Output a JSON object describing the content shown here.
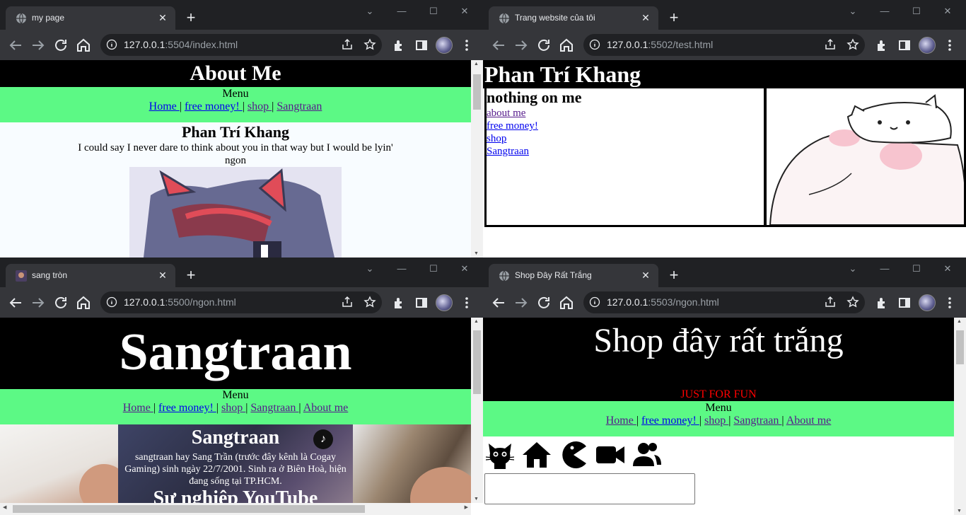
{
  "windows": [
    {
      "tab_title": "my page",
      "url_host": "127.0.0.1",
      "url_rest": ":5504/index.html",
      "page": {
        "header": "About Me",
        "menu_label": "Menu",
        "links": [
          "Home ",
          "free money! ",
          "shop ",
          "Sangtraan"
        ],
        "name": "Phan Trí Khang",
        "quote": "I could say I never dare to think about you in that way but I would be lyin'",
        "caption": "ngon"
      }
    },
    {
      "tab_title": "Trang website của tôi",
      "url_host": "127.0.0.1",
      "url_rest": ":5502/test.html",
      "page": {
        "header": "Phan Trí Khang",
        "box_title": "nothing on me",
        "links": [
          "about me",
          "free money!",
          "shop",
          "Sangtraan"
        ]
      }
    },
    {
      "tab_title": "sang tròn",
      "url_host": "127.0.0.1",
      "url_rest": ":5500/ngon.html",
      "page": {
        "header": "Sangtraan",
        "menu_label": "Menu",
        "links": [
          "Home ",
          "free money! ",
          "shop ",
          "Sangtraan ",
          "About me"
        ],
        "content_title": "Sangtraan",
        "content_text": "sangtraan hay Sang Trần (trước đây kênh là Cogay Gaming) sinh ngày 22/7/2001. Sinh ra ở Biên Hoà, hiện đang sống tại TP.HCM.",
        "content_subtitle": "Sự nghiệp YouTube"
      }
    },
    {
      "tab_title": "Shop Đây Rất Trắng",
      "url_host": "127.0.0.1",
      "url_rest": ":5503/ngon.html",
      "page": {
        "header": "Shop đây rất trắng",
        "subheader": "JUST FOR FUN",
        "menu_label": "Menu",
        "links": [
          "Home ",
          "free money! ",
          "shop ",
          "Sangtraan ",
          "About me"
        ],
        "icons": [
          "cat-icon",
          "home-icon",
          "pacman-icon",
          "video-camera-icon",
          "users-icon"
        ]
      }
    }
  ],
  "colors": {
    "menu_green": "#5cf985",
    "chrome_dark": "#202124",
    "chrome_toolbar": "#35363a",
    "link_blue": "#0000ee",
    "link_visited": "#551a8b",
    "just_for_fun_red": "#ff0000"
  }
}
